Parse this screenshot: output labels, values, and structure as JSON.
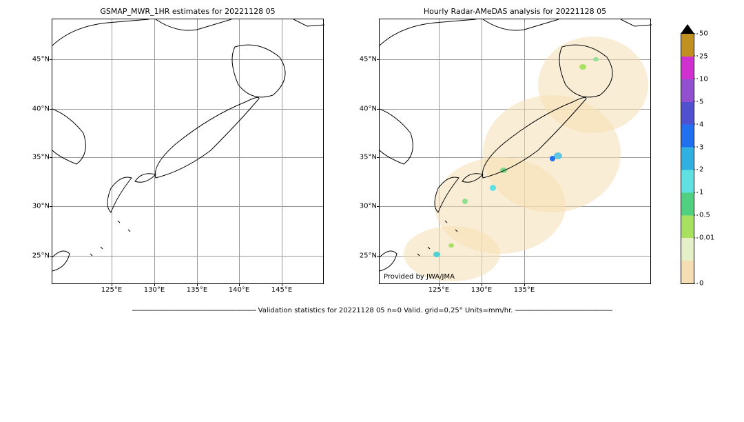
{
  "left_panel": {
    "title": "GSMAP_MWR_1HR estimates for 20221128 05",
    "lat_ticks": [
      "45°N",
      "40°N",
      "35°N",
      "30°N",
      "25°N"
    ],
    "lon_ticks": [
      "125°E",
      "130°E",
      "135°E",
      "140°E",
      "145°E"
    ]
  },
  "right_panel": {
    "title": "Hourly Radar-AMeDAS analysis for 20221128 05",
    "lat_ticks": [
      "45°N",
      "40°N",
      "35°N",
      "30°N",
      "25°N"
    ],
    "lon_ticks": [
      "125°E",
      "130°E",
      "135°E"
    ],
    "attribution": "Provided by JWA/JMA"
  },
  "colorbar": {
    "ticks": [
      "50",
      "25",
      "10",
      "5",
      "4",
      "3",
      "2",
      "1",
      "0.5",
      "0.01",
      "0"
    ]
  },
  "stats_text": "Validation statistics for 20221128 05  n=0 Valid. grid=0.25° Units=mm/hr.",
  "chart_data": {
    "type": "map",
    "description": "Two geographic map panels over Japan region comparing satellite precipitation estimate (left, empty / no precip shown) vs radar-AMeDAS analysis (right, light precipitation coverage)",
    "region": {
      "lat_range": [
        22,
        49
      ],
      "lon_range": [
        118,
        150
      ]
    },
    "left": {
      "product": "GSMAP_MWR_1HR",
      "datetime": "2022-11-28 05",
      "precip_mm_per_hr": "no observable precipitation in displayed frame"
    },
    "right": {
      "product": "Radar-AMeDAS hourly analysis",
      "datetime": "2022-11-28 05",
      "radar_coverage_shown_as": "tan shaded halo around Japanese islands (~0-0.01 mm/hr background)",
      "observed_precip_spots": [
        {
          "approx_location": "near Tokyo/Kanto coast",
          "value_mm_hr": "1-3"
        },
        {
          "approx_location": "Seto Inland / Shikoku",
          "value_mm_hr": "0.5-2"
        },
        {
          "approx_location": "southern Kyushu",
          "value_mm_hr": "0.5-2"
        },
        {
          "approx_location": "Okinawa / Ryukyu ~25N 125E",
          "value_mm_hr": "1-2"
        },
        {
          "approx_location": "Hokkaido northern coast",
          "value_mm_hr": "0.5-1"
        }
      ]
    },
    "color_scale_mm_per_hr": [
      0,
      0.01,
      0.5,
      1,
      2,
      3,
      4,
      5,
      10,
      25,
      50
    ],
    "validation": {
      "n": 0,
      "grid_deg": 0.25,
      "units": "mm/hr"
    }
  }
}
